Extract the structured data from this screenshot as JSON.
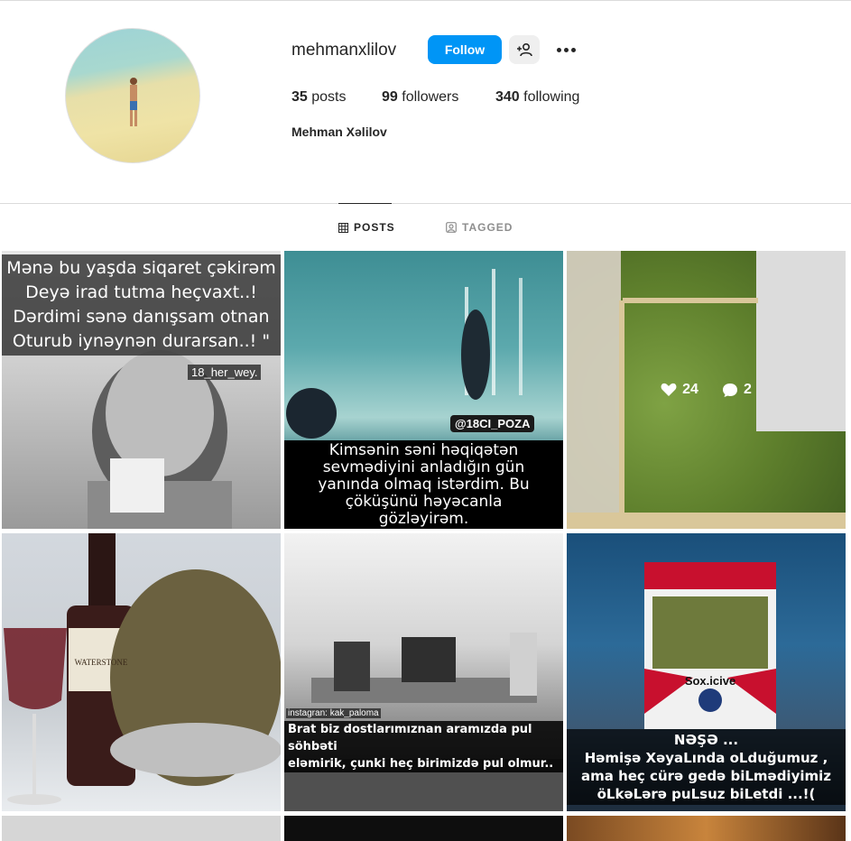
{
  "profile": {
    "username": "mehmanxlilov",
    "full_name": "Mehman Xəlilov",
    "follow_label": "Follow",
    "stats": {
      "posts_count": "35",
      "posts_label": "posts",
      "followers_count": "99",
      "followers_label": "followers",
      "following_count": "340",
      "following_label": "following"
    }
  },
  "tabs": {
    "posts": "POSTS",
    "tagged": "TAGGED"
  },
  "posts": [
    {
      "caption": "Mənə bu yaşda siqaret çəkirəm\nDeyə irad tutma heçvaxt..!\nDərdimi sənə danışsam otnan\nOturub iynəynən durarsan..! \"",
      "tag": "18_her_wey."
    },
    {
      "caption": "Kimsənin səni həqiqətən\nsevmədiyini anladığın gün\nyanında olmaq istərdim. Bu\nçöküşünü həyəcanla\ngözləyirəm.",
      "watermark": "@18CI_POZA"
    },
    {
      "likes": "24",
      "comments": "2"
    },
    {
      "label": "WATERSTONE"
    },
    {
      "caption": "Brat biz dostlarımıznan aramızda pul söhbəti\neləmirik, çunki heç birimizdə pul olmur..",
      "credit": "instagran: kak_paloma"
    },
    {
      "brand": "Sox.icive",
      "caption": "NƏŞƏ ...\nHəmişə XəyaLında oLduğumuz ,\nama heç cürə gedə biLmədiyimiz\nöLkəLərə puLsuz biLetdi ...!("
    }
  ],
  "colors": {
    "accent": "#0095f6",
    "text": "#262626",
    "muted": "#8e8e8e"
  },
  "icons": {
    "grid": "grid-icon",
    "tag": "tag-icon",
    "add_user": "add-user-icon",
    "more": "more-icon",
    "heart": "heart-icon",
    "comment": "comment-icon"
  }
}
